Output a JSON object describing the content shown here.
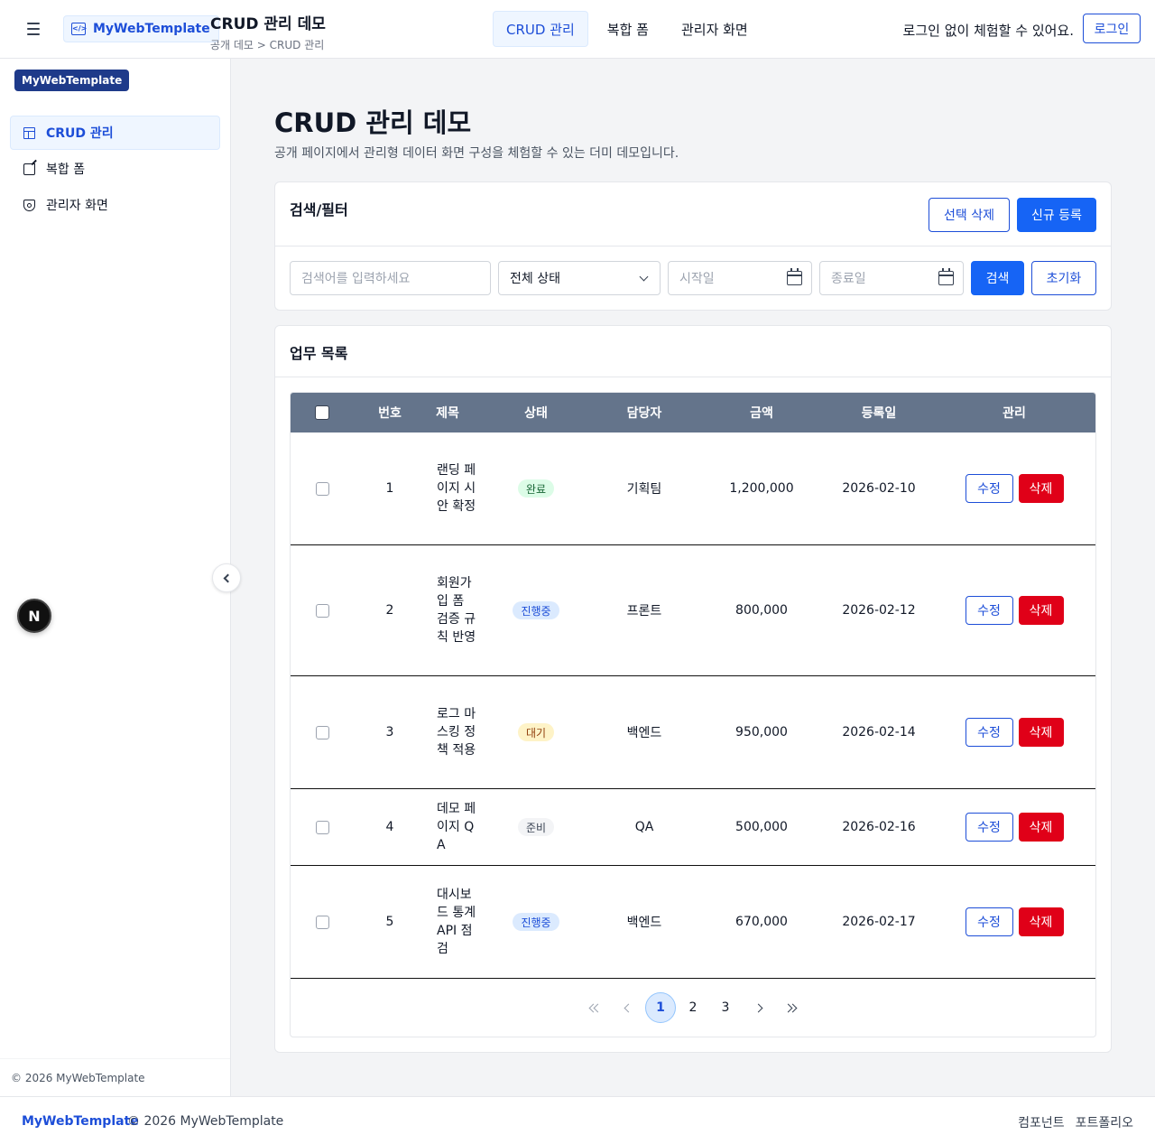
{
  "header": {
    "brand": "MyWebTemplate",
    "page_title": "CRUD 관리 데모",
    "breadcrumb": "공개 데모 > CRUD 관리",
    "nav": [
      {
        "label": "CRUD 관리",
        "active": true
      },
      {
        "label": "복합 폼",
        "active": false
      },
      {
        "label": "관리자 화면",
        "active": false
      }
    ],
    "login_message": "로그인 없이 체험할 수 있어요.",
    "login_label": "로그인"
  },
  "sidebar": {
    "brand": "MyWebTemplate",
    "items": [
      {
        "label": "CRUD 관리",
        "icon": "table-icon",
        "active": true
      },
      {
        "label": "복합 폼",
        "icon": "edit-icon",
        "active": false
      },
      {
        "label": "관리자 화면",
        "icon": "shield-icon",
        "active": false
      }
    ],
    "footer": "© 2026 MyWebTemplate",
    "floating_badge": "N"
  },
  "main": {
    "title": "CRUD 관리 데모",
    "subtitle": "공개 페이지에서 관리형 데이터 화면 구성을 체험할 수 있는 더미 데모입니다.",
    "filter": {
      "title": "검색/필터",
      "delete_selected_label": "선택 삭제",
      "create_label": "신규 등록",
      "search_placeholder": "검색어를 입력하세요",
      "status_selected": "전체 상태",
      "start_placeholder": "시작일",
      "end_placeholder": "종료일",
      "search_label": "검색",
      "reset_label": "초기화"
    },
    "list": {
      "title": "업무 목록",
      "columns": [
        "번호",
        "제목",
        "상태",
        "담당자",
        "금액",
        "등록일",
        "관리"
      ],
      "edit_label": "수정",
      "delete_label": "삭제",
      "rows": [
        {
          "no": "1",
          "title": "랜딩 페이지 시안 확정",
          "status": "완료",
          "owner": "기획팀",
          "amount": "1,200,000",
          "date": "2026-02-10"
        },
        {
          "no": "2",
          "title": "회원가입 폼 검증 규칙 반영",
          "status": "진행중",
          "owner": "프론트",
          "amount": "800,000",
          "date": "2026-02-12"
        },
        {
          "no": "3",
          "title": "로그 마스킹 정책 적용",
          "status": "대기",
          "owner": "백엔드",
          "amount": "950,000",
          "date": "2026-02-14"
        },
        {
          "no": "4",
          "title": "데모 페이지 QA",
          "status": "준비",
          "owner": "QA",
          "amount": "500,000",
          "date": "2026-02-16"
        },
        {
          "no": "5",
          "title": "대시보드 통계 API 점검",
          "status": "진행중",
          "owner": "백엔드",
          "amount": "670,000",
          "date": "2026-02-17"
        }
      ],
      "pages": [
        "1",
        "2",
        "3"
      ],
      "current_page": "1"
    }
  },
  "status_colors": {
    "완료": {
      "bg": "#dcfce7",
      "fg": "#166534"
    },
    "진행중": {
      "bg": "#dbeafe",
      "fg": "#1d4ed8"
    },
    "대기": {
      "bg": "#fef3c7",
      "fg": "#92400e"
    },
    "준비": {
      "bg": "#f3f4f6",
      "fg": "#374151"
    }
  },
  "footer": {
    "brand": "MyWebTemplate",
    "copyright": "© 2026 MyWebTemplate",
    "links": [
      "컴포넌트",
      "포트폴리오"
    ]
  }
}
